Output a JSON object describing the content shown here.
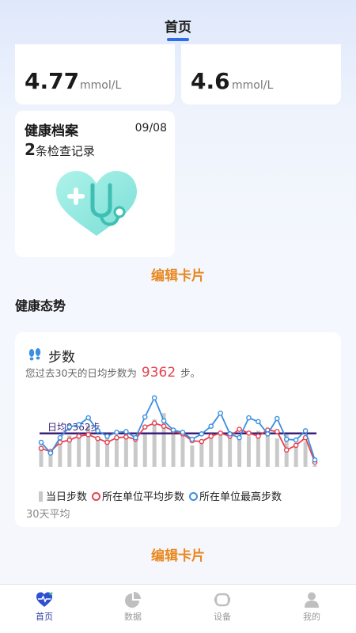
{
  "header": {
    "title": "首页"
  },
  "metrics": [
    {
      "value": "4.77",
      "unit": "mmol/L"
    },
    {
      "value": "4.6",
      "unit": "mmol/L"
    }
  ],
  "health_record": {
    "title": "健康档案",
    "date": "09/08",
    "count": "2",
    "count_suffix": "条检查记录"
  },
  "edit_card_label": "编辑卡片",
  "section_title": "健康态势",
  "steps_card": {
    "title": "步数",
    "desc_prefix": "您过去30天的日均步数为",
    "avg_value": "9362",
    "desc_suffix": "步。",
    "avg_line_label": "日均9362步",
    "legend": {
      "daily": "当日步数",
      "unit_avg": "所在单位平均步数",
      "unit_max": "所在单位最高步数",
      "avg_30": "30天平均"
    },
    "colors": {
      "bar": "#c9c9c9",
      "avg": "#e6424f",
      "max": "#3b8fe0",
      "line": "#3a2078"
    }
  },
  "chart_data": {
    "type": "bar",
    "title": "",
    "days": 30,
    "series": [
      {
        "name": "当日步数",
        "type": "bar",
        "values": [
          7800,
          6900,
          8600,
          9100,
          9300,
          10400,
          8600,
          9200,
          8800,
          9700,
          9100,
          9500,
          11200,
          12000,
          9900,
          9500,
          7800,
          8200,
          9000,
          9500,
          8800,
          9100,
          9000,
          9700,
          9500,
          8700,
          9400,
          7700,
          8300,
          5200
        ]
      },
      {
        "name": "所在单位平均步数",
        "type": "line",
        "values": [
          7400,
          7000,
          8200,
          8500,
          9000,
          9200,
          8700,
          8200,
          8800,
          8900,
          8600,
          10200,
          10700,
          10300,
          9700,
          9300,
          8400,
          8300,
          9000,
          9400,
          9000,
          9900,
          9400,
          9000,
          9800,
          9600,
          7200,
          7800,
          8800,
          5600
        ]
      },
      {
        "name": "所在单位最高步数",
        "type": "line",
        "values": [
          8200,
          6800,
          8800,
          10200,
          10500,
          11400,
          9700,
          9000,
          9500,
          9600,
          8800,
          11500,
          14000,
          11000,
          9800,
          9500,
          8600,
          9300,
          10300,
          12000,
          9300,
          8800,
          11400,
          10900,
          9300,
          11300,
          8600,
          8500,
          9700,
          5900
        ]
      }
    ],
    "reference_line": {
      "label": "日均9362步",
      "value": 9362
    },
    "ylim": [
      5000,
      14500
    ]
  },
  "tabs": [
    {
      "label": "首页",
      "icon": "heart-pulse-icon",
      "active": true
    },
    {
      "label": "数据",
      "icon": "pie-chart-icon",
      "active": false
    },
    {
      "label": "设备",
      "icon": "watch-icon",
      "active": false
    },
    {
      "label": "我的",
      "icon": "user-icon",
      "active": false
    }
  ]
}
